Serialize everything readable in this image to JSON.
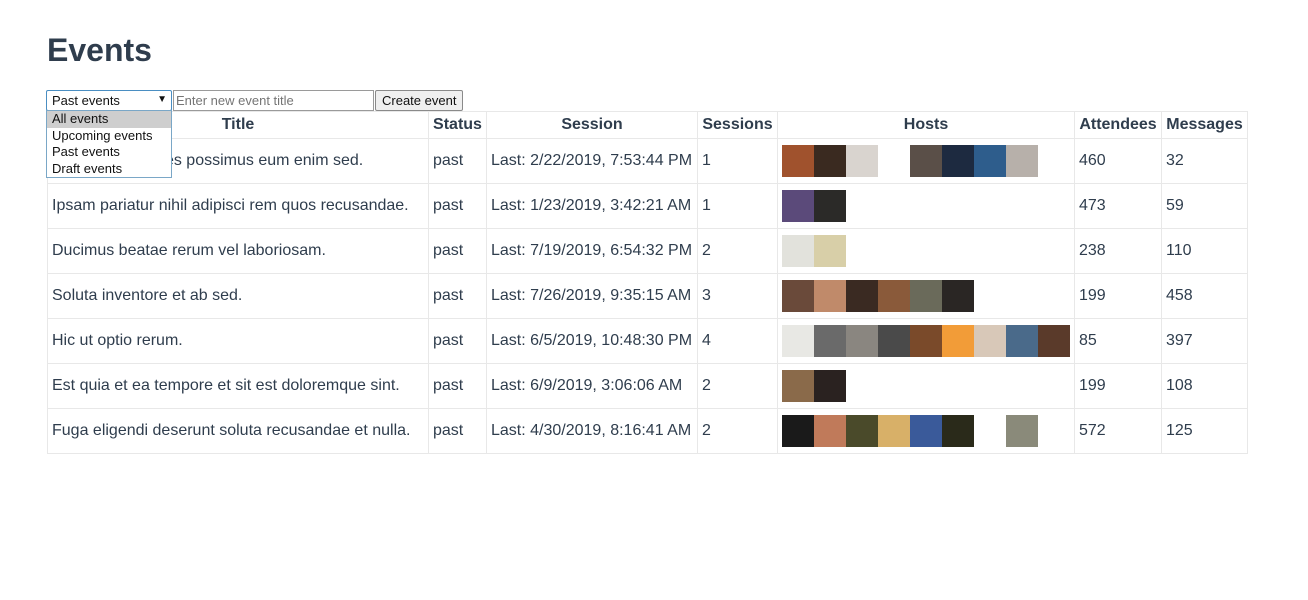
{
  "page": {
    "title": "Events"
  },
  "filter": {
    "selected": "Past events",
    "options": [
      "All events",
      "Upcoming events",
      "Past events",
      "Draft events"
    ],
    "highlighted_index": 0
  },
  "new_event": {
    "placeholder": "Enter new event title",
    "value": "",
    "button_label": "Create event"
  },
  "table": {
    "headers": [
      "Title",
      "Status",
      "Session",
      "Sessions",
      "Hosts",
      "Attendees",
      "Messages"
    ],
    "rows": [
      {
        "title": "Quisquam dolores possimus eum enim sed.",
        "status": "past",
        "session": "Last: 2/22/2019, 7:53:44 PM",
        "sessions": "1",
        "hosts": [
          "#a0522d",
          "#3a2a20",
          "#d9d4cf",
          "#ffffff",
          "#5a4f48",
          "#1d2a40",
          "#2e5d8c",
          "#b7b0aa"
        ],
        "attendees": "460",
        "messages": "32"
      },
      {
        "title": "Ipsam pariatur nihil adipisci rem quos recusandae.",
        "status": "past",
        "session": "Last: 1/23/2019, 3:42:21 AM",
        "sessions": "1",
        "hosts": [
          "#5b4a7a",
          "#2b2a28"
        ],
        "attendees": "473",
        "messages": "59"
      },
      {
        "title": "Ducimus beatae rerum vel laboriosam.",
        "status": "past",
        "session": "Last: 7/19/2019, 6:54:32 PM",
        "sessions": "2",
        "hosts": [
          "#e2e2dc",
          "#d8cfa8"
        ],
        "attendees": "238",
        "messages": "110"
      },
      {
        "title": "Soluta inventore et ab sed.",
        "status": "past",
        "session": "Last: 7/26/2019, 9:35:15 AM",
        "sessions": "3",
        "hosts": [
          "#6a4a3a",
          "#c08a6a",
          "#3a2a22",
          "#8a5a3a",
          "#6a6a5a",
          "#2a2624"
        ],
        "attendees": "199",
        "messages": "458"
      },
      {
        "title": "Hic ut optio rerum.",
        "status": "past",
        "session": "Last: 6/5/2019, 10:48:30 PM",
        "sessions": "4",
        "hosts": [
          "#e8e8e4",
          "#6a6a6a",
          "#8a8680",
          "#4a4a4a",
          "#7a4a2a",
          "#f29c38",
          "#d8c8b8",
          "#4a6a8a",
          "#5a3a2a"
        ],
        "attendees": "85",
        "messages": "397"
      },
      {
        "title": "Est quia et ea tempore et sit est doloremque sint.",
        "status": "past",
        "session": "Last: 6/9/2019, 3:06:06 AM",
        "sessions": "2",
        "hosts": [
          "#8a6a4a",
          "#2a2220",
          "#ffffff"
        ],
        "attendees": "199",
        "messages": "108"
      },
      {
        "title": "Fuga eligendi deserunt soluta recusandae et nulla.",
        "status": "past",
        "session": "Last: 4/30/2019, 8:16:41 AM",
        "sessions": "2",
        "hosts": [
          "#1a1a1a",
          "#c07a5a",
          "#4a4a2a",
          "#d8b068",
          "#3a5a9a",
          "#2a2a1a",
          "#ffffff",
          "#8a8a7a"
        ],
        "attendees": "572",
        "messages": "125"
      }
    ]
  }
}
